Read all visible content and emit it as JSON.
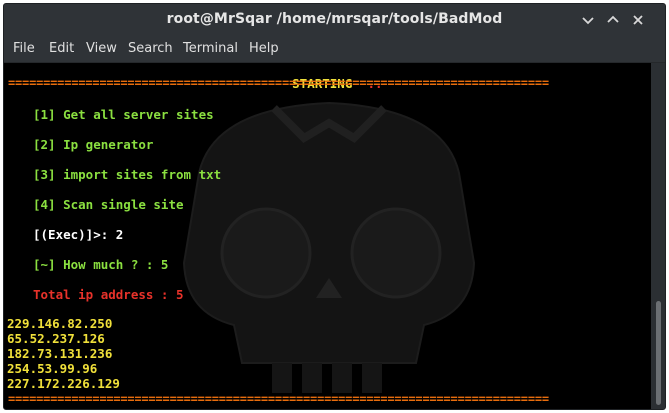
{
  "window": {
    "title": "root@MrSqar /home/mrsqar/tools/BadMod"
  },
  "menu": {
    "items": [
      "File",
      "Edit",
      "View",
      "Search",
      "Terminal",
      "Help"
    ]
  },
  "terminal": {
    "header_label": "STARTING",
    "header_dots": "..",
    "rule": "=============================================================================",
    "options": [
      "[1] Get all server sites",
      "[2] Ip generator",
      "[3] import sites from txt",
      "[4] Scan single site"
    ],
    "exec_prompt": "[(Exec)]>: 2",
    "how_much_prompt": "[~] How much ? : 5",
    "total_ip": "Total ip address : 5",
    "ip_list": [
      "229.146.82.250",
      "65.52.237.126",
      "182.73.131.236",
      "254.53.99.96",
      "227.172.226.129"
    ]
  },
  "colors": {
    "rule": "#e86d0d",
    "header": "#f0e03a",
    "menu_text": "#8be040",
    "prompt": "#ffffff",
    "total": "#e8322a",
    "ip": "#f0e03a"
  },
  "icons": {
    "minimize": "chevron-down-icon",
    "maximize": "chevron-up-icon",
    "close": "close-icon"
  }
}
